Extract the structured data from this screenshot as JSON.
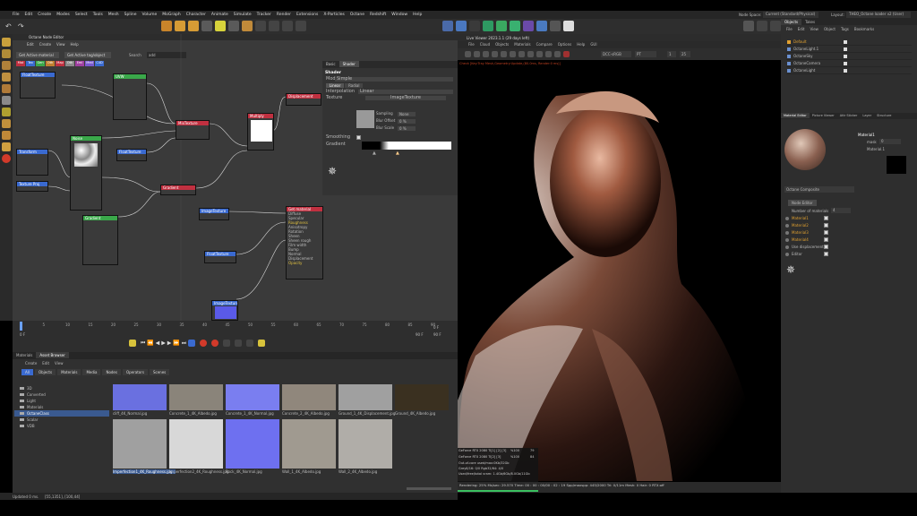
{
  "menubar": {
    "items": [
      "File",
      "Edit",
      "Create",
      "Modes",
      "Select",
      "Tools",
      "Mesh",
      "Spline",
      "Volume",
      "MoGraph",
      "Character",
      "Animate",
      "Simulate",
      "Tracker",
      "Render",
      "Extensions",
      "X-Particles",
      "Octane",
      "Redshift",
      "Window",
      "Help"
    ],
    "node_space_label": "Node Space:",
    "node_space_value": "Current (Standard/Physical)",
    "layout_label": "Layout:",
    "layout_value": "THEO_Octane loader v2 (User)"
  },
  "node_editor": {
    "title": "Octane Node Editor",
    "menu": [
      "Edit",
      "Create",
      "View",
      "Help"
    ],
    "btn_active_material": "Get Active material",
    "btn_active_tag": "Get Active tag/object",
    "search_label": "Search",
    "search_value": "add",
    "tabs": [
      "Mat",
      "Tex",
      "Gen",
      "Oth",
      "Map",
      "Oth",
      "Emi",
      "Med",
      "C4D"
    ],
    "nodes": {
      "image_texture": "ImageTexture",
      "gradient": "Gradient",
      "mix_texture": "MixTexture",
      "float_texture": "FloatTexture",
      "transform": "Transform",
      "texture_proj": "Texture Proj",
      "noise": "Noise",
      "uvw": "UVW",
      "displacement": "Displacement",
      "multiply": "Multiply",
      "float_texture2": "FloatTexture",
      "get_material": "Get material",
      "image_texture2": "ImageTexture",
      "gradient2": "Gradient"
    },
    "get_material_pins": [
      "Diffuse",
      "Specular",
      "Roughness",
      "Anisotropy",
      "Rotation",
      "Sheen",
      "Sheen rough",
      "Film width",
      "Bump",
      "Normal",
      "Displacement",
      "Opacity"
    ]
  },
  "shader": {
    "tabs": [
      "Basic",
      "Shader"
    ],
    "header": "Shader",
    "mode_label": "Mode",
    "mode_value": "Simple",
    "sub_tabs": [
      "Linear",
      "Radial"
    ],
    "interp_label": "Interpolation",
    "interp_value": "Linear",
    "texture_label": "Texture",
    "texture_value": "ImageTexture",
    "sampling_label": "Sampling",
    "sampling_value": "None",
    "blur_offset_label": "Blur Offset",
    "blur_offset_value": "0 %",
    "blur_scale_label": "Blur Scale",
    "blur_scale_value": "0 %",
    "smoothing_label": "Smoothing",
    "gradient_label": "Gradient"
  },
  "timeline": {
    "ticks": [
      "0",
      "5",
      "10",
      "15",
      "20",
      "25",
      "30",
      "35",
      "40",
      "45",
      "50",
      "55",
      "60",
      "65",
      "70",
      "75",
      "80",
      "85",
      "90"
    ],
    "start": "0 F",
    "end": "90 F",
    "cur": "0 F",
    "end2": "90 F"
  },
  "asset_browser": {
    "tabs": [
      "Materials",
      "Asset Browser"
    ],
    "menu": [
      "Create",
      "Edit",
      "View"
    ],
    "filters": [
      "All",
      "Objects",
      "Materials",
      "Media",
      "Nodes",
      "Operators",
      "Scenes"
    ],
    "tree": [
      "3D",
      "Converted",
      "Light",
      "Materials",
      "OctaneClass",
      "Scalar",
      "VDB"
    ],
    "assets": [
      {
        "name": "cliff_4K_Normal.jpg",
        "color": "#6a70e0"
      },
      {
        "name": "Concrete_1_4K_Albedo.jpg",
        "color": "#8a847a"
      },
      {
        "name": "Concrete_1_4K_Normal.jpg",
        "color": "#7a7ef0"
      },
      {
        "name": "Concrete_2_4K_Albedo.jpg",
        "color": "#90877c"
      },
      {
        "name": "Ground_1_4K_Displacement.jpg",
        "color": "#a0a0a0"
      },
      {
        "name": "Ground_4K_Albedo.jpg",
        "color": "#3a3020"
      },
      {
        "name": "Imperfection1_4K_Roughness.jpg",
        "color": "#a0a0a0"
      },
      {
        "name": "Imperfection2_4K_Roughness.jpg",
        "color": "#d8d8d8"
      },
      {
        "name": "Rock_4K_Normal.jpg",
        "color": "#6e70f0"
      },
      {
        "name": "Wall_1_4K_Albedo.jpg",
        "color": "#a09a90"
      },
      {
        "name": "Wall_2_4K_Albedo.jpg",
        "color": "#b0ada8"
      }
    ],
    "status": "Updated 0 ms.",
    "coords": "[55,1351], [100,44]"
  },
  "live_viewer": {
    "title": "Live Viewer 2023.1.1 (29 days left)",
    "menu": [
      "File",
      "Cloud",
      "Objects",
      "Materials",
      "Compare",
      "Options",
      "Help",
      "GUI"
    ],
    "info_line": "Check [Key:Tray Mesh,Geometry:Update,(80.0ms, Render:0 ms)]",
    "select_value": "DCC-sRGB",
    "mode_value": "PT",
    "frame_value": "1",
    "samples": "25",
    "gpu": [
      {
        "name": "GeForce RTX 2080 Ti[1] [2] [3]",
        "pct": "%100",
        "temp": "79"
      },
      {
        "name": "GeForce RTX 2080 Ti[2] [3]",
        "pct": "%100",
        "temp": "84"
      }
    ],
    "stats": [
      "Out-of-core used/max:0Kb/32Gb",
      "Grey8/16: 0/0          Rgb32/64: 4/0",
      "Used/free/total vram: 1.4Gb/6Gb/8.0Gb/11Gb"
    ],
    "bottom": "Rendering: 25%   Ms/sec: 29.570   Time: 00 : 00 : 00/00 : 02 : 19   Spp/maxspp: 445/2000   Tri: 0/11m   Mesh: 0   Hair: 0   RTX:off"
  },
  "objects": {
    "tabs": [
      "Objects",
      "Takes"
    ],
    "menu": [
      "File",
      "Edit",
      "View",
      "Object",
      "Tags",
      "Bookmarks"
    ],
    "items": [
      "Default",
      "OctaneLight.1",
      "OctaneSky",
      "OctaneCamera",
      "OctaneLight"
    ]
  },
  "attributes": {
    "tabs": [
      "Material Editor",
      "Picture Viewer",
      "Attr Sticker",
      "Layer",
      "Structure"
    ],
    "material_name": "Material1",
    "mask_label": "mask",
    "mask_value": "0",
    "material_ref": "Material.1",
    "composite_label": "Octane Composite",
    "node_editor_btn": "Node Editor",
    "num_materials_label": "Number of materials",
    "num_materials_value": "4",
    "list": [
      "Material1",
      "Material2",
      "Material3",
      "Material4",
      "Use displacement",
      "Editor"
    ]
  }
}
